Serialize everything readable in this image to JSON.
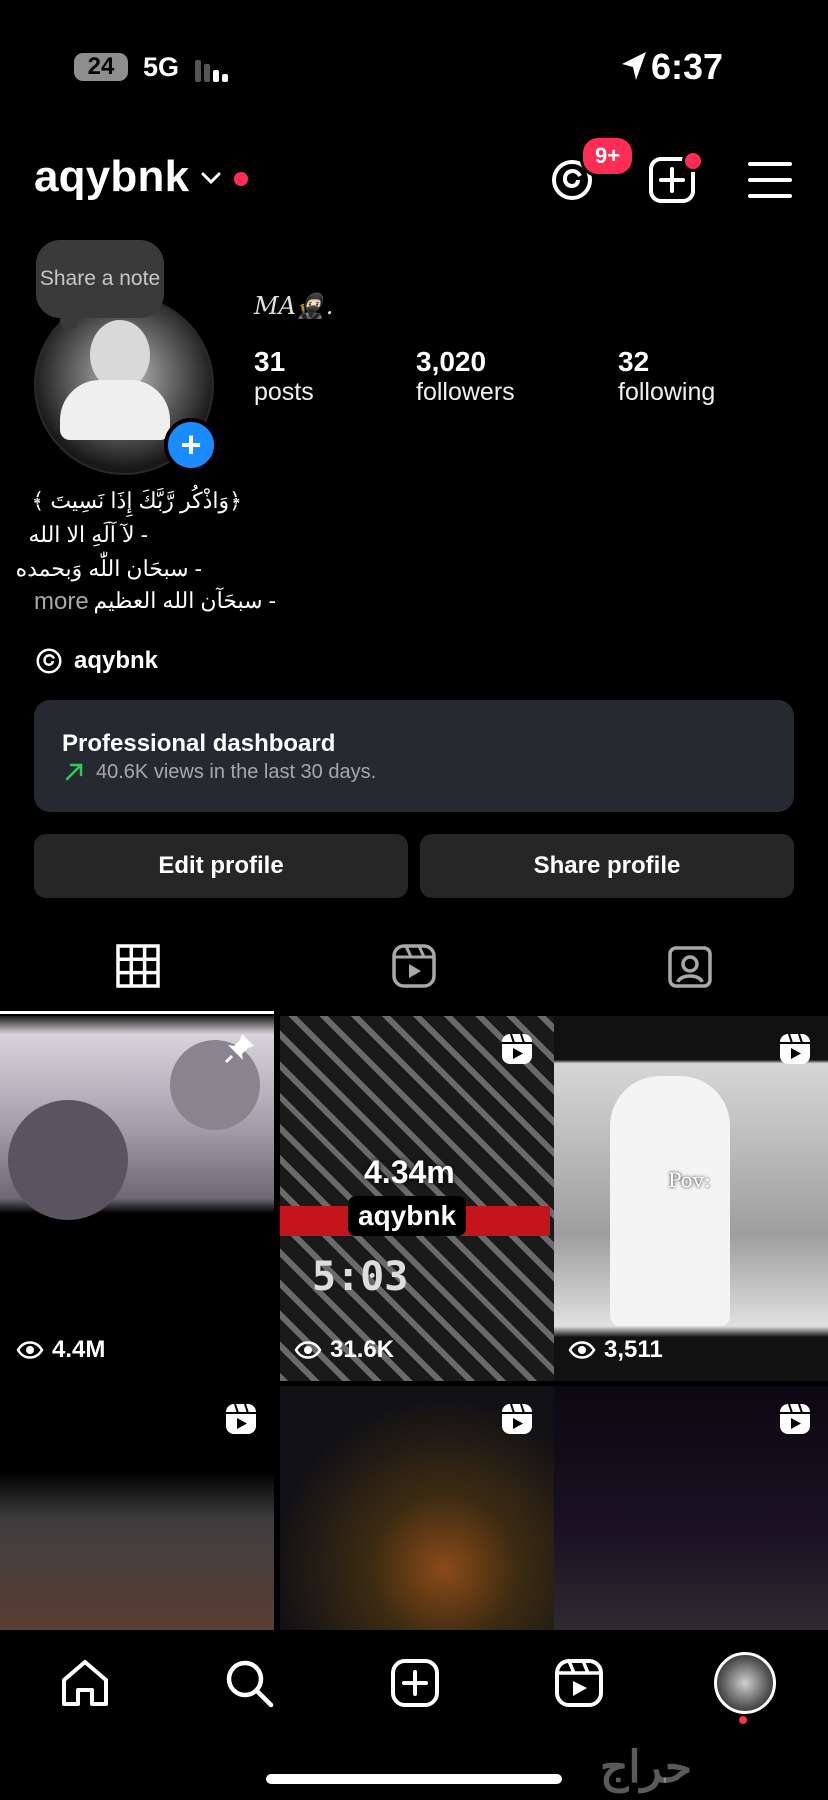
{
  "status_bar": {
    "battery": "24",
    "network": "5G",
    "time": "6:37"
  },
  "header": {
    "username": "aqybnk",
    "threads_badge": "9+"
  },
  "profile": {
    "note_text": "Share a note",
    "display_name": "MA🥷🏻.",
    "stats": [
      {
        "value": "31",
        "label": "posts"
      },
      {
        "value": "3,020",
        "label": "followers"
      },
      {
        "value": "32",
        "label": "following"
      }
    ],
    "bio_lines": [
      "﴿وَاذْكُر رَّبَّكَ إِذَا نَسِيتَ ﴾",
      "- لآ آلَهِ الا الله",
      "- سبحَان اللّٰه وَبحمده",
      "- سبحَآن الله العظيم"
    ],
    "more_label": "more",
    "threads_handle": "aqybnk"
  },
  "dashboard": {
    "title": "Professional dashboard",
    "subtitle": "40.6K views in the last 30 days."
  },
  "buttons": {
    "edit": "Edit profile",
    "share": "Share profile"
  },
  "grid": [
    {
      "views": "4.4M",
      "type": "pinned"
    },
    {
      "views": "31.6K",
      "type": "reel",
      "overlay_big": "4.34m",
      "overlay_name": "aqybnk",
      "overlay_time": "5:03"
    },
    {
      "views": "3,511",
      "type": "reel",
      "overlay_text": "Pov:"
    },
    {
      "views": "",
      "type": "reel"
    },
    {
      "views": "",
      "type": "reel"
    },
    {
      "views": "",
      "type": "reel"
    }
  ],
  "watermark": "حراج",
  "colors": {
    "accent_blue": "#1a8cff",
    "notification_red": "#ff2d55",
    "card_bg": "#262a30",
    "button_bg": "#262626"
  }
}
